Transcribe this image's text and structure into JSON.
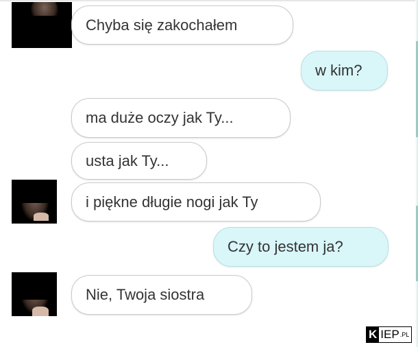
{
  "conversation": {
    "messages": [
      {
        "direction": "incoming",
        "text": "Chyba się zakochałem"
      },
      {
        "direction": "outgoing",
        "text": "w kim?"
      },
      {
        "direction": "incoming",
        "text": "ma duże oczy jak Ty..."
      },
      {
        "direction": "incoming",
        "text": "usta jak Ty..."
      },
      {
        "direction": "incoming",
        "text": "i piękne długie nogi jak Ty"
      },
      {
        "direction": "outgoing",
        "text": "Czy to jestem ja?"
      },
      {
        "direction": "incoming",
        "text": "Nie, Twoja siostra"
      }
    ]
  },
  "watermark": {
    "logo_text": "KIEP.PL",
    "k": "K",
    "iep": "IEP",
    "pl": ".PL"
  },
  "colors": {
    "incoming_bubble": "#ffffff",
    "outgoing_bubble": "#d9f6f9",
    "text": "#333333"
  }
}
